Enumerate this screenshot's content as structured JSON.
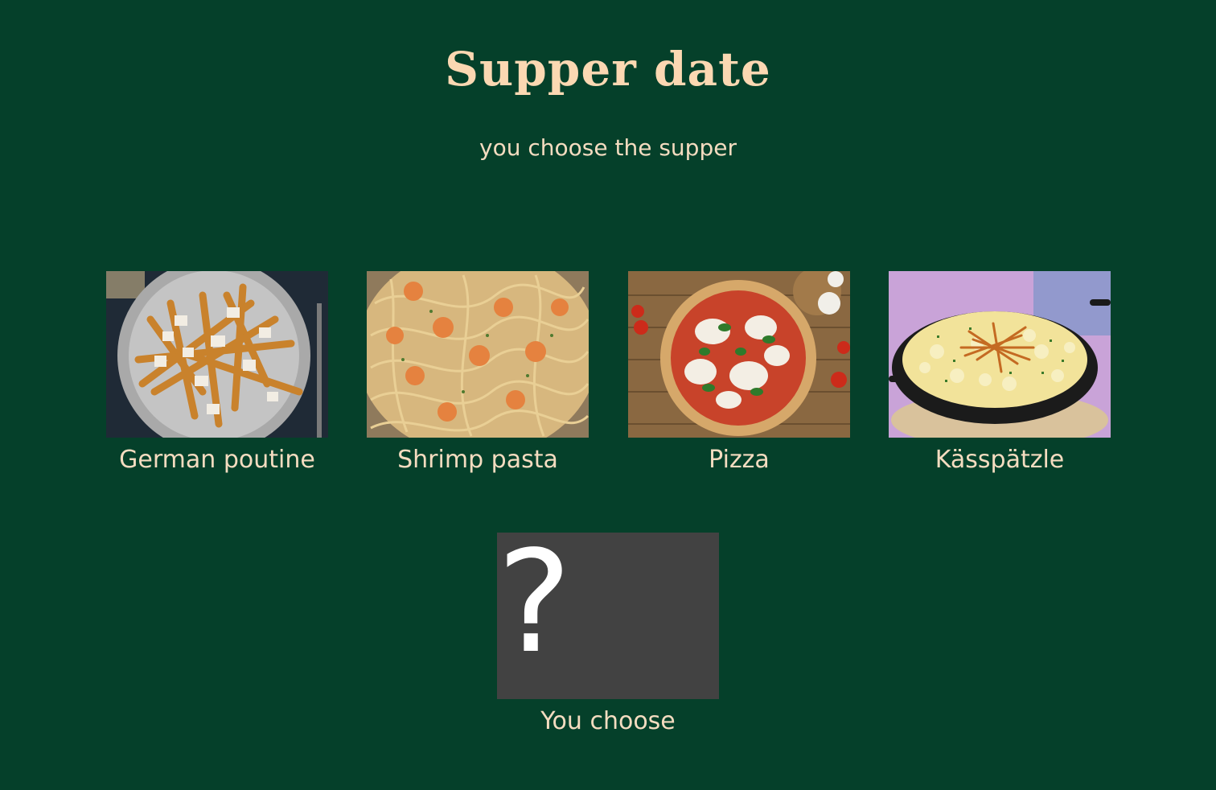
{
  "page": {
    "title": "Supper date",
    "subtitle": "you choose the supper"
  },
  "options": [
    {
      "label": "German poutine",
      "image": "poutine-photo"
    },
    {
      "label": "Shrimp pasta",
      "image": "shrimp-pasta-photo"
    },
    {
      "label": "Pizza",
      "image": "pizza-photo"
    },
    {
      "label": "Kässpätzle",
      "image": "kasspatzle-photo"
    }
  ],
  "custom": {
    "label": "You choose",
    "symbol": "?"
  },
  "colors": {
    "background": "#05402a",
    "title": "#fbd8b2",
    "text": "#f4dcc0",
    "mystery_tile": "#424242"
  }
}
